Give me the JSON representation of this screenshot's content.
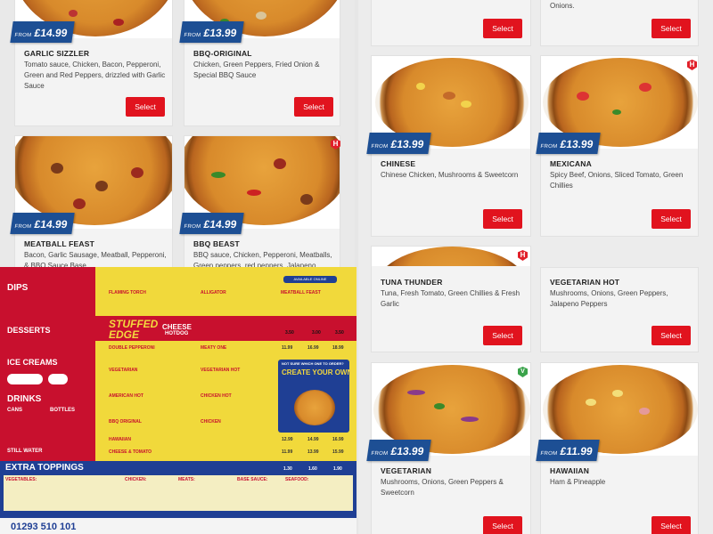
{
  "cards": [
    {
      "id": "garlic-sizzler",
      "from": "FROM",
      "price": "£14.99",
      "name": "GARLIC SIZZLER",
      "desc": "Tomato sauce, Chicken, Bacon, Pepperoni, Green and Red Peppers, drizzled with Garlic Sauce",
      "button": "Select"
    },
    {
      "id": "bbq-original",
      "from": "FROM",
      "price": "£13.99",
      "name": "BBQ-ORIGINAL",
      "desc": "Chicken, Green Peppers, Fried Onion & Special BBQ Sauce",
      "button": "Select"
    },
    {
      "id": "meatball-feast",
      "from": "FROM",
      "price": "£14.99",
      "name": "MEATBALL FEAST",
      "desc": "Bacon, Garlic Sausage, Meatball, Pepperoni, & BBQ Sauce Base",
      "button": "Select"
    },
    {
      "id": "bbq-beast",
      "from": "FROM",
      "price": "£14.99",
      "name": "BBQ BEAST",
      "desc": "BBQ sauce, Chicken, Pepperoni, Meatballs, Green peppers, red peppers, Jalapeno",
      "button": "Select"
    },
    {
      "id": "onions-top",
      "from": "",
      "price": "",
      "name": "",
      "desc": "Onions.",
      "button": "Select"
    },
    {
      "id": "top-left-right",
      "from": "",
      "price": "",
      "name": "",
      "desc": "",
      "button": "Select"
    },
    {
      "id": "chinese",
      "from": "FROM",
      "price": "£13.99",
      "name": "CHINESE",
      "desc": "Chinese Chicken, Mushrooms & Sweetcorn",
      "button": "Select"
    },
    {
      "id": "mexicana",
      "from": "FROM",
      "price": "£13.99",
      "name": "MEXICANA",
      "desc": "Spicy Beef, Onions, Sliced Tomato, Green Chillies",
      "button": "Select"
    },
    {
      "id": "tuna-thunder",
      "from": "",
      "price": "",
      "name": "TUNA THUNDER",
      "desc": "Tuna, Fresh Tomato, Green Chillies & Fresh Garlic",
      "button": "Select"
    },
    {
      "id": "vegetarian-hot",
      "from": "",
      "price": "",
      "name": "VEGETARIAN HOT",
      "desc": "Mushrooms, Onions, Green Peppers, Jalapeno Peppers",
      "button": "Select"
    },
    {
      "id": "vegetarian",
      "from": "FROM",
      "price": "£13.99",
      "name": "VEGETARIAN",
      "desc": "Mushrooms, Onions, Green Peppers & Sweetcorn",
      "button": "Select"
    },
    {
      "id": "hawaiian",
      "from": "FROM",
      "price": "£11.99",
      "name": "HAWAIIAN",
      "desc": "Ham & Pineapple",
      "button": "Select"
    }
  ],
  "icons": {
    "hot": "H",
    "veg": "V"
  },
  "flyer": {
    "dips": "DIPS",
    "desserts": "DESSERTS",
    "ice_creams": "ICE CREAMS",
    "drinks": "DRINKS",
    "cans": "CANS",
    "bottles": "BOTTLES",
    "still_water": "STILL WATER",
    "stuffed": "STUFFED",
    "edge": "EDGE",
    "cheese": "CHEESE",
    "hotdog": "HOTDOG",
    "flaming_torch": "FLAMING TORCH",
    "alligator": "ALLIGATOR",
    "meatball_feast": "MEATBALL FEAST",
    "double_pepperoni": "DOUBLE PEPPERONI",
    "meaty_one": "MEATY ONE",
    "vegetarian": "VEGETARIAN",
    "vegetarian_hot": "VEGETARIAN HOT",
    "american_hot": "AMERICAN HOT",
    "chicken_hot": "CHICKEN HOT",
    "bbq_original": "BBQ ORIGINAL",
    "chicken": "CHICKEN",
    "hawaiian": "HAWAIIAN",
    "cheese_tomato": "CHEESE & TOMATO",
    "create_your_own": "CREATE YOUR OWN",
    "not_sure": "NOT SURE WHICH ONE TO ORDER?",
    "online": "AVAILABLE ONLINE",
    "row_prices": [
      [
        "3.50",
        "3.00",
        "3.50"
      ],
      [
        "11.99",
        "16.99",
        "18.99"
      ],
      [
        "12.99",
        "14.99",
        "16.99"
      ],
      [
        "11.99",
        "13.99",
        "15.99"
      ],
      [
        "1.30",
        "1.60",
        "1.90"
      ]
    ],
    "extra_toppings": "EXTRA TOPPINGS",
    "cats": [
      "VEGETABLES:",
      "CHICKEN:",
      "MEATS:",
      "BASE SAUCE:",
      "SEAFOOD:"
    ],
    "phone": "01293 510 101"
  }
}
